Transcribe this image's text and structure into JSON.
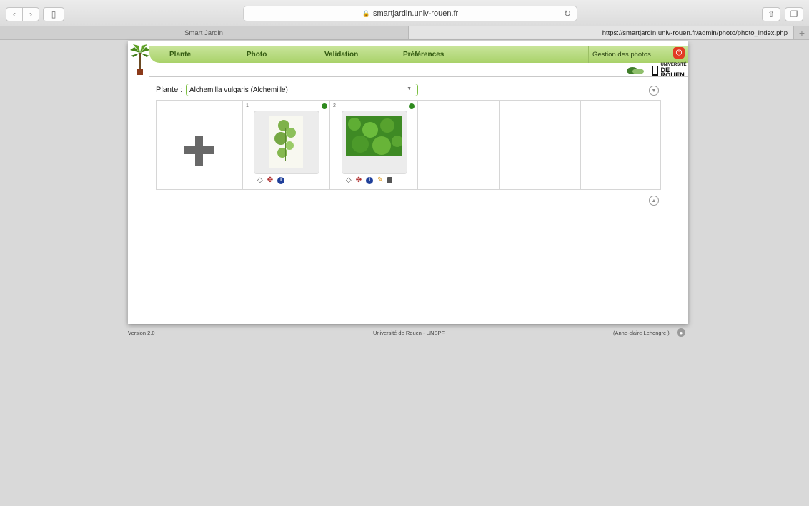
{
  "browser": {
    "url": "smartjardin.univ-rouen.fr",
    "tabs": [
      {
        "label": "Smart Jardin"
      },
      {
        "label": "https://smartjardin.univ-rouen.fr/admin/photo/photo_index.php"
      }
    ],
    "icons": {
      "back": "chevron-left-icon",
      "forward": "chevron-right-icon",
      "sidebar": "sidebar-icon",
      "reload": "reload-icon",
      "share": "share-icon",
      "tabs": "tabs-icon",
      "new_tab": "plus-icon"
    }
  },
  "menu": {
    "items": [
      {
        "label": "Plante"
      },
      {
        "label": "Photo"
      },
      {
        "label": "Validation"
      },
      {
        "label": "Préférences"
      }
    ],
    "section_title": "Gestion des photos"
  },
  "logos": {
    "university_small": "UNIVERSITÉ",
    "university_big": "DE ROUEN"
  },
  "plant_selector": {
    "label": "Plante :",
    "value": "Alchemilla vulgaris (Alchemille)"
  },
  "photos": {
    "cells": [
      {
        "number": "1"
      },
      {
        "number": "2"
      }
    ]
  },
  "footer": {
    "version": "Version 2.0",
    "institution": "Université de Rouen - UNSPF",
    "user": "(Anne-claire Lehongre )"
  },
  "colors": {
    "menu_green": "#b5d980",
    "select_border": "#7cbf42",
    "power_red": "#e23b23",
    "status_green": "#2e8a1e"
  }
}
